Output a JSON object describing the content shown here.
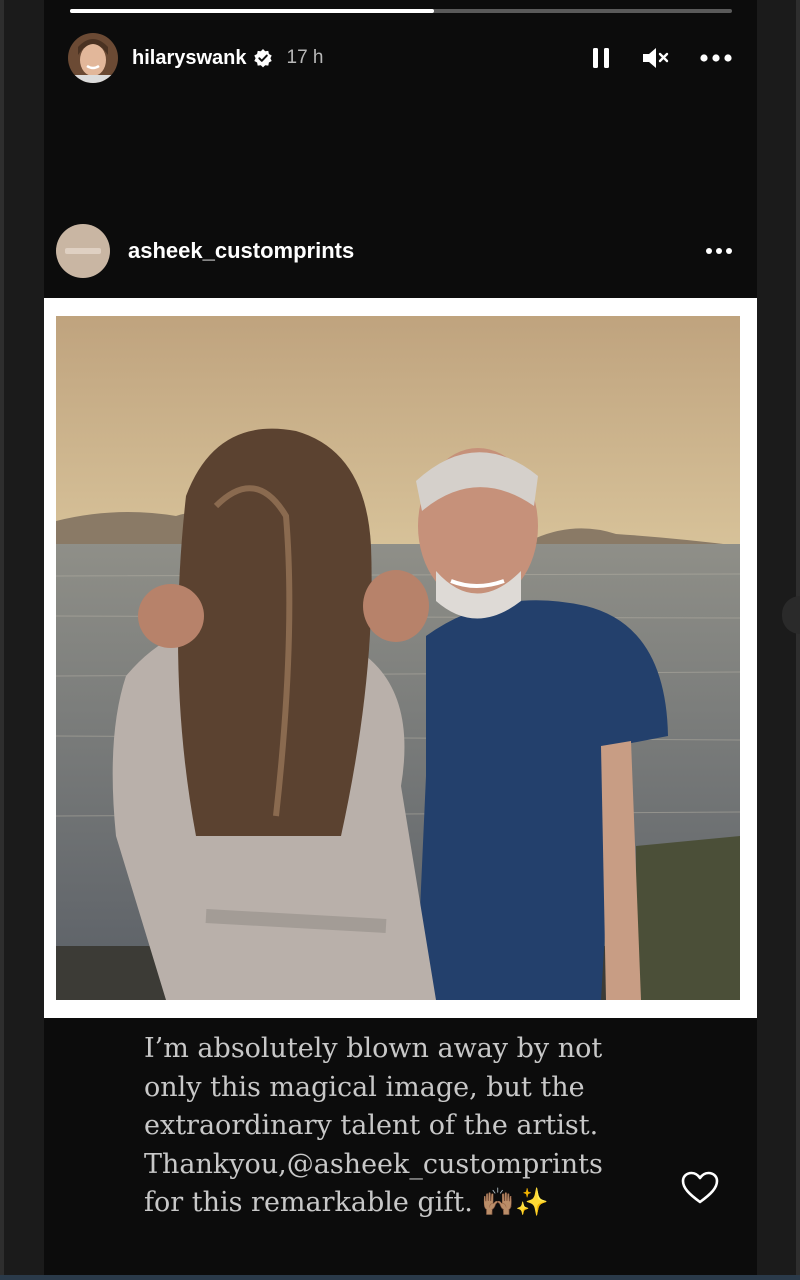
{
  "story": {
    "username": "hilaryswank",
    "time": "17 h",
    "progress": 0.55
  },
  "post": {
    "username": "asheek_customprints"
  },
  "caption": {
    "lines": [
      "I’m absolutely blown away by not",
      "only this magical image, but the",
      "extraordinary talent of the artist.",
      "Thankyou,@asheek_customprints",
      "for this remarkable gift. 🙌🏽✨"
    ]
  },
  "icons": {
    "verified": "verified-badge-icon",
    "pause": "pause-icon",
    "mute": "muted-speaker-icon",
    "more": "more-options-icon",
    "heart": "heart-icon"
  }
}
